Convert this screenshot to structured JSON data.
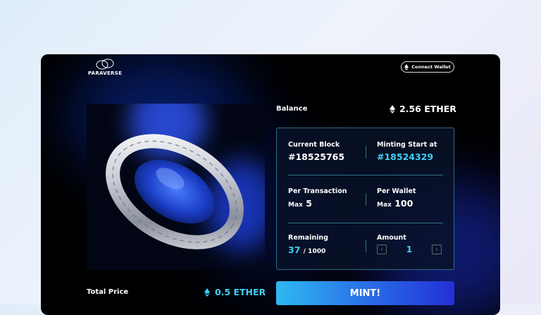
{
  "brand": {
    "name": "PARAVERSE"
  },
  "header": {
    "connect_wallet_label": "Connect Wallet"
  },
  "balance": {
    "label": "Balance",
    "value": "2.56 ETHER"
  },
  "stats": {
    "current_block": {
      "label": "Current Block",
      "value": "#18525765"
    },
    "minting_start": {
      "label": "Minting Start at",
      "value": "#18524329"
    },
    "per_transaction": {
      "label": "Per Transaction",
      "prefix": "Max",
      "value": "5"
    },
    "per_wallet": {
      "label": "Per Wallet",
      "prefix": "Max",
      "value": "100"
    },
    "remaining": {
      "label": "Remaining",
      "value": "37",
      "total": "/ 1000"
    },
    "amount": {
      "label": "Amount",
      "value": "1",
      "decrement": "‹",
      "increment": "›"
    }
  },
  "total_price": {
    "label": "Total Price",
    "value": "0.5 ETHER"
  },
  "mint": {
    "label": "MINT!"
  },
  "colors": {
    "accent": "#3fd0f5",
    "background": "#000000",
    "button_gradient": [
      "#2fb9f0",
      "#2330d8"
    ]
  },
  "icons": [
    "paraverse-logo-icon",
    "ethereum-icon",
    "chevron-left-icon",
    "chevron-right-icon"
  ]
}
